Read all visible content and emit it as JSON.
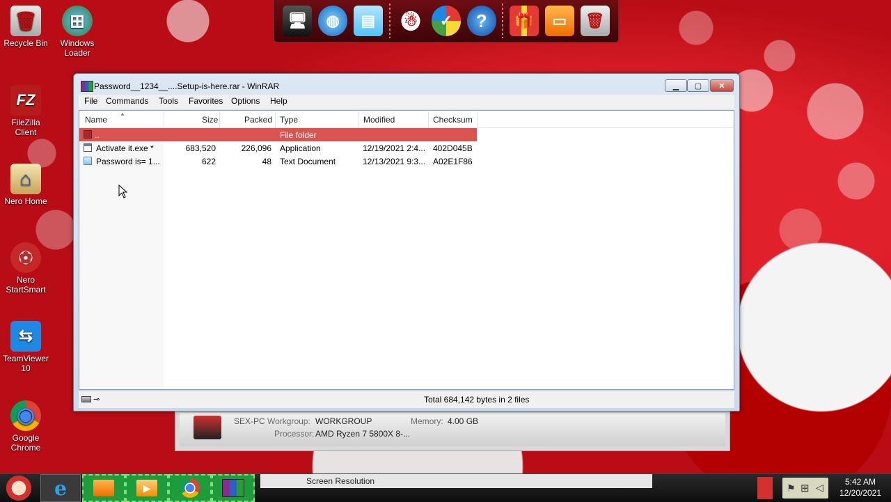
{
  "desktop_icons": [
    {
      "label": "Recycle Bin",
      "icon": "recycle-bin-icon",
      "glyph": "🗑"
    },
    {
      "label": "Windows Loader",
      "icon": "windows-loader-icon",
      "glyph": "⊞"
    },
    {
      "label": "FileZilla Client",
      "icon": "filezilla-icon",
      "glyph": "FZ"
    },
    {
      "label": "Nero Home",
      "icon": "nero-home-icon",
      "glyph": "⌂"
    },
    {
      "label": "Nero StartSmart",
      "icon": "nero-startsmart-icon",
      "glyph": "✿"
    },
    {
      "label": "TeamViewer 10",
      "icon": "teamviewer-icon",
      "glyph": "⇆"
    },
    {
      "label": "Google Chrome",
      "icon": "chrome-icon",
      "glyph": "◉"
    }
  ],
  "dock": {
    "icons": [
      "computer-icon",
      "network-icon",
      "control-panel-icon",
      "snowman-icon",
      "checkmark-icon",
      "help-icon",
      "gift-icon",
      "folder-icon",
      "recycle-bin-icon"
    ]
  },
  "window": {
    "title": "Password__1234__....Setup-is-here.rar - WinRAR",
    "menu": [
      "File",
      "Commands",
      "Tools",
      "Favorites",
      "Options",
      "Help"
    ],
    "columns": [
      "Name",
      "Size",
      "Packed",
      "Type",
      "Modified",
      "Checksum"
    ],
    "rows": [
      {
        "name": "..",
        "size": "",
        "packed": "",
        "type": "File folder",
        "modified": "",
        "checksum": "",
        "selected": true
      },
      {
        "name": "Activate it.exe *",
        "size": "683,520",
        "packed": "226,096",
        "type": "Application",
        "modified": "12/19/2021 2:4...",
        "checksum": "402D045B",
        "selected": false
      },
      {
        "name": "Password is=  1...",
        "size": "622",
        "packed": "48",
        "type": "Text Document",
        "modified": "12/13/2021 9:3...",
        "checksum": "A02E1F86",
        "selected": false
      }
    ],
    "status": "Total 684,142 bytes in 2 files"
  },
  "sysinfo": {
    "computer_name": "SEX-PC",
    "workgroup_label": "Workgroup:",
    "workgroup": "WORKGROUP",
    "memory_label": "Memory:",
    "memory": "4.00 GB",
    "processor_label": "Processor:",
    "processor": "AMD Ryzen 7 5800X 8-..."
  },
  "taskbar": {
    "screen_resolution": "Screen Resolution",
    "time": "5:42 AM",
    "date": "12/20/2021"
  },
  "colors": {
    "selection": "#d9534f",
    "taskbar_green": "#1e9b3b"
  }
}
